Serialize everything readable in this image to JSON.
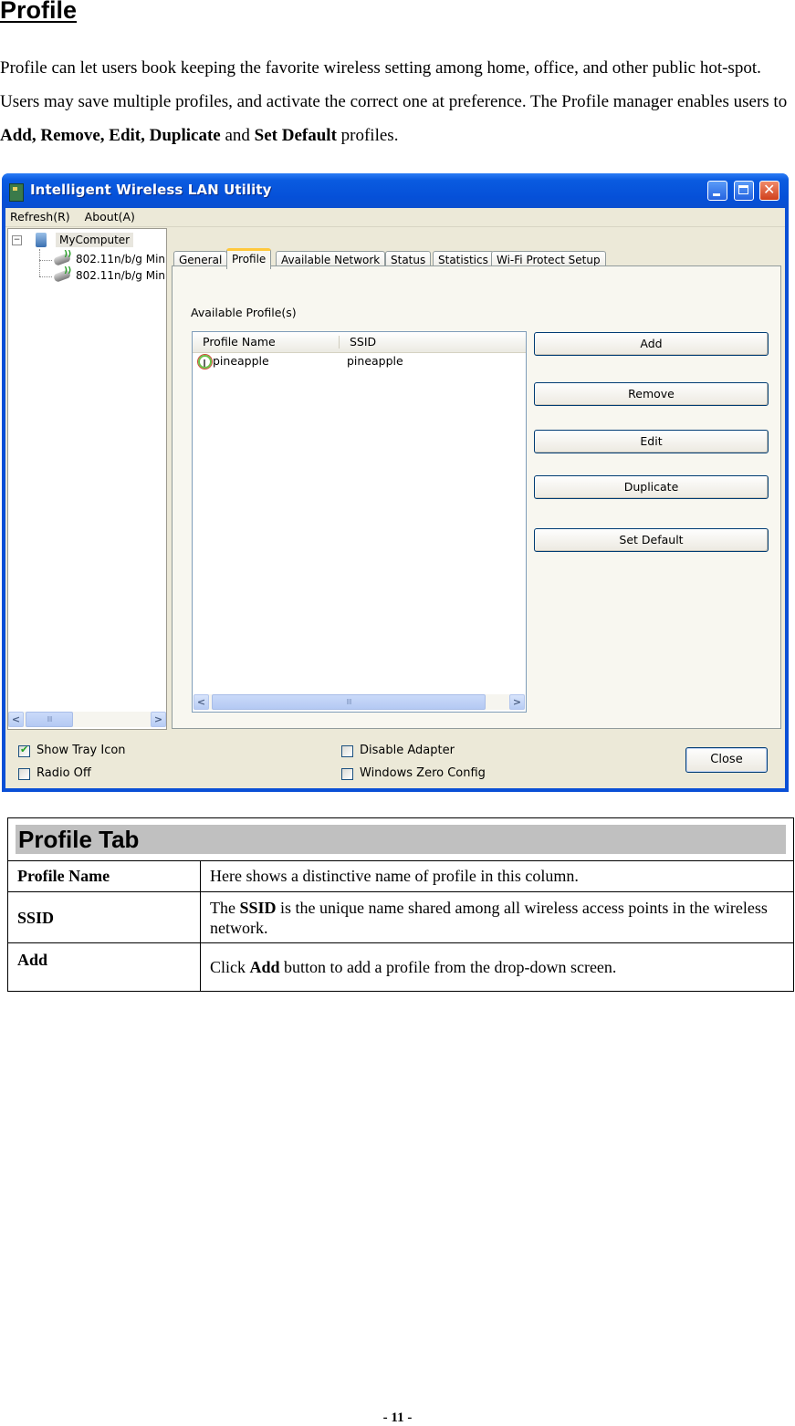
{
  "doc": {
    "heading": "Profile",
    "intro_parts": [
      {
        "text": "Profile can let users book keeping the favorite wireless setting among home, office, and other public hot-spot. Users may save multiple profiles, and activate the correct one at preference. The Profile manager enables users to ",
        "bold": false
      },
      {
        "text": "Add, Remove, Edit, Duplicate",
        "bold": true
      },
      {
        "text": " and ",
        "bold": false
      },
      {
        "text": "Set Default",
        "bold": true
      },
      {
        "text": " profiles.",
        "bold": false
      }
    ],
    "page_number": "- 11 -"
  },
  "window": {
    "title": "Intelligent Wireless LAN Utility",
    "menu": [
      "Refresh(R)",
      "About(A)"
    ],
    "tree": {
      "root": "MyComputer",
      "root_expander": "−",
      "children": [
        "802.11n/b/g Min",
        "802.11n/b/g Min"
      ]
    },
    "tabs": [
      {
        "label": "General",
        "active": false
      },
      {
        "label": "Profile",
        "active": true
      },
      {
        "label": "Available Network",
        "active": false
      },
      {
        "label": "Status",
        "active": false
      },
      {
        "label": "Statistics",
        "active": false
      },
      {
        "label": "Wi-Fi Protect Setup",
        "active": false
      }
    ],
    "profile_panel": {
      "label": "Available Profile(s)",
      "columns": [
        "Profile Name",
        "SSID"
      ],
      "rows": [
        {
          "profile_name": "pineapple",
          "ssid": "pineapple"
        }
      ],
      "buttons": [
        "Add",
        "Remove",
        "Edit",
        "Duplicate",
        "Set Default"
      ]
    },
    "scroll_thumb_glyph": "IIII",
    "checkboxes": [
      {
        "label": "Show Tray Icon",
        "checked": true
      },
      {
        "label": "Radio Off",
        "checked": false
      },
      {
        "label": "Disable Adapter",
        "checked": false
      },
      {
        "label": "Windows Zero Config",
        "checked": false
      }
    ],
    "close_button": "Close",
    "icons": {
      "minimize": "minimize-icon",
      "maximize": "maximize-icon",
      "close": "close-icon"
    }
  },
  "table": {
    "title": "Profile Tab",
    "rows": [
      {
        "term": "Profile Name",
        "desc_parts": [
          {
            "text": "Here shows a distinctive name of profile in this column.",
            "bold": false
          }
        ]
      },
      {
        "term": "SSID",
        "desc_parts": [
          {
            "text": "The ",
            "bold": false
          },
          {
            "text": "SSID",
            "bold": true
          },
          {
            "text": " is the unique name shared among all wireless access points in the wireless network.",
            "bold": false
          }
        ]
      },
      {
        "term": "Add",
        "desc_parts": [
          {
            "text": "Click ",
            "bold": false
          },
          {
            "text": "Add",
            "bold": true
          },
          {
            "text": " button to add a profile from the drop-down screen.",
            "bold": false
          }
        ]
      }
    ]
  }
}
